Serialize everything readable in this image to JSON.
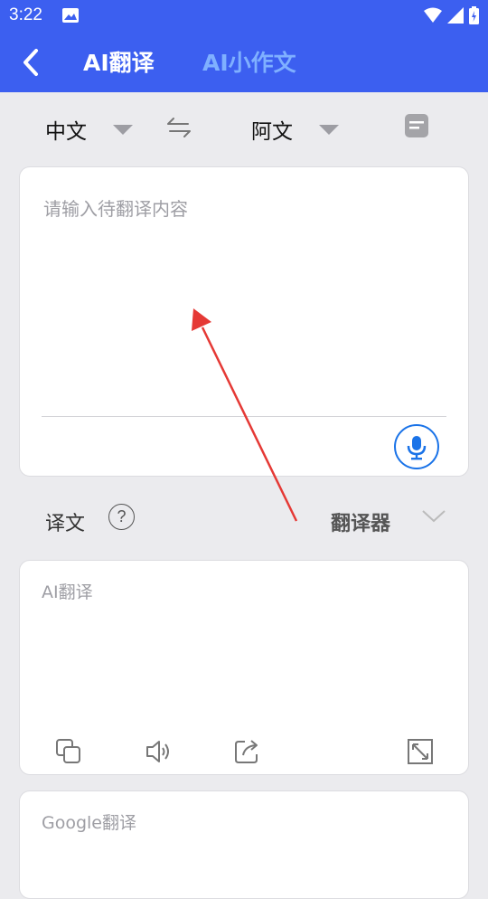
{
  "status_bar": {
    "time": "3:22"
  },
  "header": {
    "tabs": [
      {
        "label": "AI翻译"
      },
      {
        "label": "AI小作文"
      }
    ]
  },
  "languages": {
    "source": "中文",
    "target": "阿文"
  },
  "input": {
    "placeholder": "请输入待翻译内容"
  },
  "translation": {
    "label": "译文",
    "help": "?",
    "engine": "翻译器"
  },
  "results": [
    {
      "title": "AI翻译"
    },
    {
      "title": "Google翻译"
    }
  ],
  "colors": {
    "header": "#3c5ff0",
    "active_tab": "#ffffff",
    "inactive_tab": "#7fb0ff",
    "mic": "#1a73e8",
    "annotation_arrow": "#e53935"
  },
  "icons": [
    "image-icon",
    "wifi-icon",
    "signal-icon",
    "battery-icon",
    "back-arrow-icon",
    "dropdown-caret-icon",
    "swap-languages-icon",
    "message-icon",
    "microphone-icon",
    "help-icon",
    "chevron-down-icon",
    "copy-icon",
    "speaker-icon",
    "share-icon",
    "expand-icon"
  ]
}
